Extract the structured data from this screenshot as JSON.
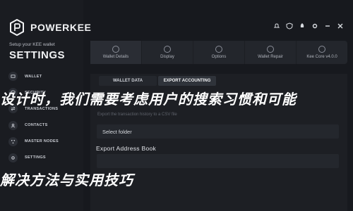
{
  "brand": {
    "name": "POWERKEE"
  },
  "sidebar": {
    "setup_text": "Setup your KEE wallet",
    "title": "SETTINGS",
    "items": [
      {
        "label": "WALLET",
        "icon": "wallet-icon"
      },
      {
        "label": "SECURITY",
        "icon": "shield-icon"
      },
      {
        "label": "TRANSACTIONS",
        "icon": "transactions-icon"
      },
      {
        "label": "CONTACTS",
        "icon": "contacts-icon"
      },
      {
        "label": "MASTER NODES",
        "icon": "nodes-icon"
      },
      {
        "label": "SETTINGS",
        "icon": "gear-icon"
      }
    ]
  },
  "top_icons": [
    "bell-icon",
    "shield-icon",
    "rocket-icon",
    "settings-icon",
    "minimize-icon",
    "close-icon"
  ],
  "tabs": [
    {
      "label": "Wallet Details",
      "active": true
    },
    {
      "label": "Display",
      "active": false
    },
    {
      "label": "Options",
      "active": false
    },
    {
      "label": "Wallet Repair",
      "active": false
    },
    {
      "label": "Kee Core v4.0.0",
      "active": false
    }
  ],
  "subtabs": [
    {
      "label": "WALLET DATA",
      "active": false
    },
    {
      "label": "EXPORT ACCOUNTING",
      "active": true
    }
  ],
  "export": {
    "note": "Export the transaction history to a CSV file",
    "select_label": "Select folder",
    "address_book_title": "Export Address Book"
  },
  "overlay": {
    "line1": "设计时，我们需要考虑用户的搜索习惯和可能",
    "line2": "解决方法与实用技巧"
  },
  "colors": {
    "background": "#17191e",
    "panel": "#1d1f24",
    "field": "#24272d",
    "text": "#e6e8ec"
  }
}
